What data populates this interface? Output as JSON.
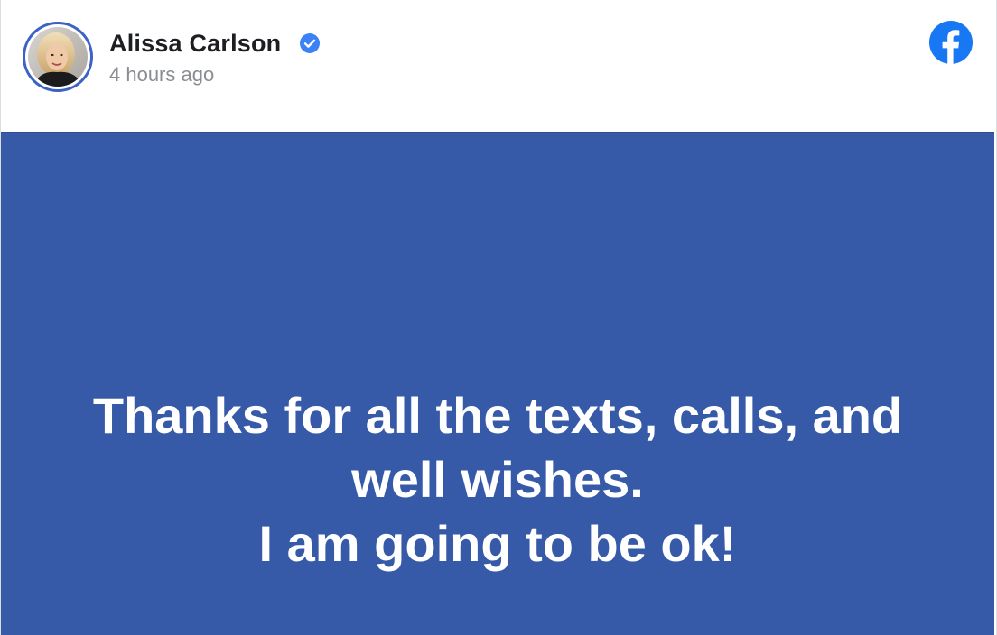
{
  "post": {
    "author_name": "Alissa Carlson",
    "timestamp": "4 hours ago",
    "verified": true,
    "network_logo": "facebook-icon",
    "status_lines": [
      "Thanks for all the texts, calls, and",
      "well wishes.",
      "I am going to be ok!"
    ]
  },
  "colors": {
    "brand_blue": "#1877f2",
    "status_background": "#365aa8",
    "verified_badge": "#3b82f6",
    "avatar_ring": "#3b62c4",
    "name_text": "#1c1e21",
    "timestamp_text": "#8a8d91"
  },
  "icons": {
    "verified": "verified-badge-icon",
    "logo": "facebook-icon"
  }
}
